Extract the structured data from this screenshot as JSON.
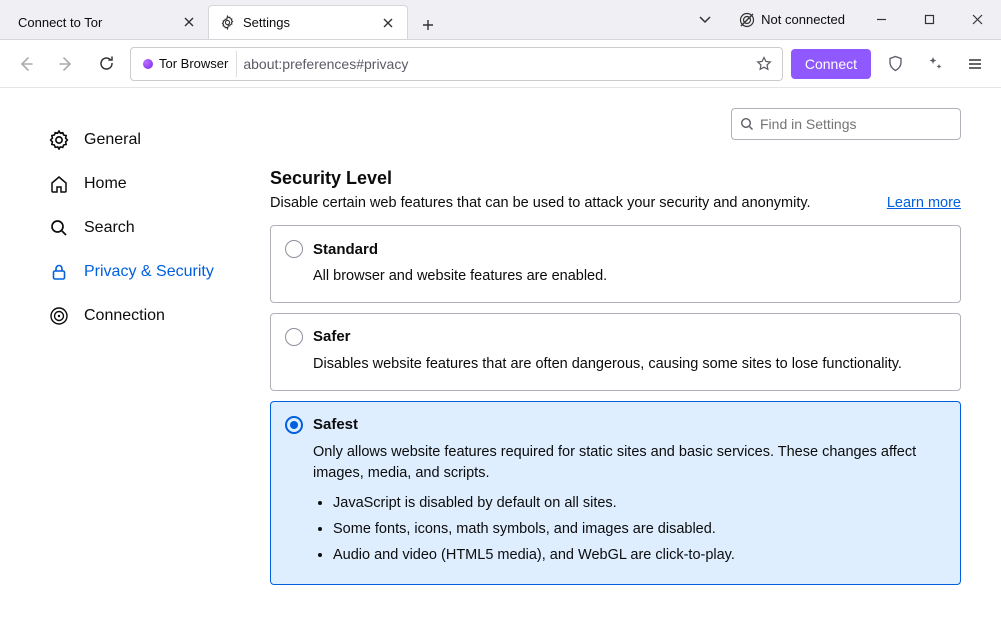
{
  "tabs": [
    {
      "title": "Connect to Tor",
      "active": false
    },
    {
      "title": "Settings",
      "active": true
    }
  ],
  "titlebar": {
    "status_label": "Not connected"
  },
  "toolbar": {
    "identity_label": "Tor Browser",
    "url": "about:preferences#privacy",
    "connect_label": "Connect"
  },
  "sidebar": {
    "items": [
      {
        "label": "General"
      },
      {
        "label": "Home"
      },
      {
        "label": "Search"
      },
      {
        "label": "Privacy & Security"
      },
      {
        "label": "Connection"
      }
    ]
  },
  "main": {
    "search_placeholder": "Find in Settings",
    "section_title": "Security Level",
    "section_subtitle": "Disable certain web features that can be used to attack your security and anonymity.",
    "learn_more": "Learn more",
    "options": [
      {
        "title": "Standard",
        "desc": "All browser and website features are enabled.",
        "selected": false
      },
      {
        "title": "Safer",
        "desc": "Disables website features that are often dangerous, causing some sites to lose functionality.",
        "selected": false
      },
      {
        "title": "Safest",
        "desc": "Only allows website features required for static sites and basic services. These changes affect images, media, and scripts.",
        "bullets": [
          "JavaScript is disabled by default on all sites.",
          "Some fonts, icons, math symbols, and images are disabled.",
          "Audio and video (HTML5 media), and WebGL are click-to-play."
        ],
        "selected": true
      }
    ]
  }
}
